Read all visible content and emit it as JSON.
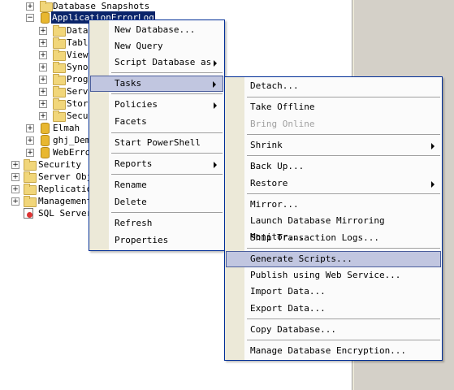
{
  "tree": {
    "nodes": [
      {
        "label": "Database Snapshots"
      },
      {
        "label": "ApplicationErrorLog"
      },
      {
        "label": "Datab"
      },
      {
        "label": "Table"
      },
      {
        "label": "Views"
      },
      {
        "label": "Synon"
      },
      {
        "label": "Progr"
      },
      {
        "label": "Servi"
      },
      {
        "label": "Stora"
      },
      {
        "label": "Secur"
      },
      {
        "label": "Elmah"
      },
      {
        "label": "ghj_Demo"
      },
      {
        "label": "WebError"
      },
      {
        "label": "Security"
      },
      {
        "label": "Server Obje"
      },
      {
        "label": "Replication"
      },
      {
        "label": "Management"
      },
      {
        "label": "SQL Server"
      }
    ],
    "expander_plus": "+",
    "expander_minus": "−"
  },
  "context_menu": {
    "items": [
      "New Database...",
      "New Query",
      "Script Database as",
      "Tasks",
      "Policies",
      "Facets",
      "Start PowerShell",
      "Reports",
      "Rename",
      "Delete",
      "Refresh",
      "Properties"
    ]
  },
  "tasks_menu": {
    "items": [
      "Detach...",
      "Take Offline",
      "Bring Online",
      "Shrink",
      "Back Up...",
      "Restore",
      "Mirror...",
      "Launch Database Mirroring Monitor...",
      "Ship Transaction Logs...",
      "Generate Scripts...",
      "Publish using Web Service...",
      "Import Data...",
      "Export Data...",
      "Copy Database...",
      "Manage Database Encryption..."
    ]
  }
}
